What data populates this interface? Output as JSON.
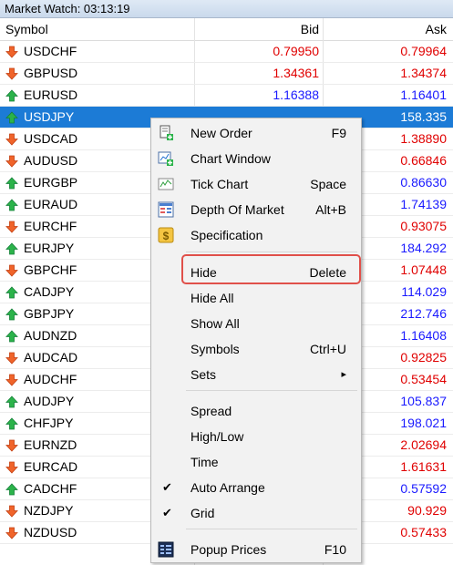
{
  "window": {
    "title": "Market Watch: 03:13:19"
  },
  "columns": {
    "symbol": "Symbol",
    "bid": "Bid",
    "ask": "Ask"
  },
  "rows": [
    {
      "symbol": "USDCHF",
      "bid": "0.79950",
      "ask": "0.79964",
      "dir": "down"
    },
    {
      "symbol": "GBPUSD",
      "bid": "1.34361",
      "ask": "1.34374",
      "dir": "down"
    },
    {
      "symbol": "EURUSD",
      "bid": "1.16388",
      "ask": "1.16401",
      "dir": "up"
    },
    {
      "symbol": "USDJPY",
      "bid": "",
      "ask": "158.335",
      "dir": "up",
      "selected": true
    },
    {
      "symbol": "USDCAD",
      "bid": "",
      "ask": "1.38890",
      "dir": "down"
    },
    {
      "symbol": "AUDUSD",
      "bid": "",
      "ask": "0.66846",
      "dir": "down"
    },
    {
      "symbol": "EURGBP",
      "bid": "",
      "ask": "0.86630",
      "dir": "up"
    },
    {
      "symbol": "EURAUD",
      "bid": "",
      "ask": "1.74139",
      "dir": "up"
    },
    {
      "symbol": "EURCHF",
      "bid": "",
      "ask": "0.93075",
      "dir": "down"
    },
    {
      "symbol": "EURJPY",
      "bid": "",
      "ask": "184.292",
      "dir": "up"
    },
    {
      "symbol": "GBPCHF",
      "bid": "",
      "ask": "1.07448",
      "dir": "down"
    },
    {
      "symbol": "CADJPY",
      "bid": "",
      "ask": "114.029",
      "dir": "up"
    },
    {
      "symbol": "GBPJPY",
      "bid": "",
      "ask": "212.746",
      "dir": "up"
    },
    {
      "symbol": "AUDNZD",
      "bid": "",
      "ask": "1.16408",
      "dir": "up"
    },
    {
      "symbol": "AUDCAD",
      "bid": "",
      "ask": "0.92825",
      "dir": "down"
    },
    {
      "symbol": "AUDCHF",
      "bid": "",
      "ask": "0.53454",
      "dir": "down"
    },
    {
      "symbol": "AUDJPY",
      "bid": "",
      "ask": "105.837",
      "dir": "up"
    },
    {
      "symbol": "CHFJPY",
      "bid": "",
      "ask": "198.021",
      "dir": "up"
    },
    {
      "symbol": "EURNZD",
      "bid": "",
      "ask": "2.02694",
      "dir": "down"
    },
    {
      "symbol": "EURCAD",
      "bid": "",
      "ask": "1.61631",
      "dir": "down"
    },
    {
      "symbol": "CADCHF",
      "bid": "",
      "ask": "0.57592",
      "dir": "up"
    },
    {
      "symbol": "NZDJPY",
      "bid": "",
      "ask": "90.929",
      "dir": "down"
    },
    {
      "symbol": "NZDUSD",
      "bid": "",
      "ask": "0.57433",
      "dir": "down"
    }
  ],
  "context_menu": {
    "items": [
      {
        "label": "New Order",
        "shortcut": "F9",
        "icon": "new-order-icon"
      },
      {
        "label": "Chart Window",
        "shortcut": "",
        "icon": "chart-window-icon"
      },
      {
        "label": "Tick Chart",
        "shortcut": "Space",
        "icon": "tick-chart-icon"
      },
      {
        "label": "Depth Of Market",
        "shortcut": "Alt+B",
        "icon": "depth-of-market-icon"
      },
      {
        "label": "Specification",
        "shortcut": "",
        "icon": "specification-icon"
      },
      {
        "label": "Hide",
        "shortcut": "Delete",
        "highlighted": true
      },
      {
        "label": "Hide All",
        "shortcut": ""
      },
      {
        "label": "Show All",
        "shortcut": ""
      },
      {
        "label": "Symbols",
        "shortcut": "Ctrl+U"
      },
      {
        "label": "Sets",
        "shortcut": "",
        "submenu": true
      },
      {
        "label": "Spread",
        "shortcut": ""
      },
      {
        "label": "High/Low",
        "shortcut": ""
      },
      {
        "label": "Time",
        "shortcut": ""
      },
      {
        "label": "Auto Arrange",
        "shortcut": "",
        "checked": true
      },
      {
        "label": "Grid",
        "shortcut": "",
        "checked": true
      },
      {
        "label": "Popup Prices",
        "shortcut": "F10",
        "icon": "popup-prices-icon"
      }
    ],
    "check_glyph": "✔",
    "submenu_glyph": "▸"
  },
  "colors": {
    "up": "#1a1aff",
    "down": "#e00000",
    "selected": "#1c7bd6",
    "highlight_box": "#e0504a"
  }
}
